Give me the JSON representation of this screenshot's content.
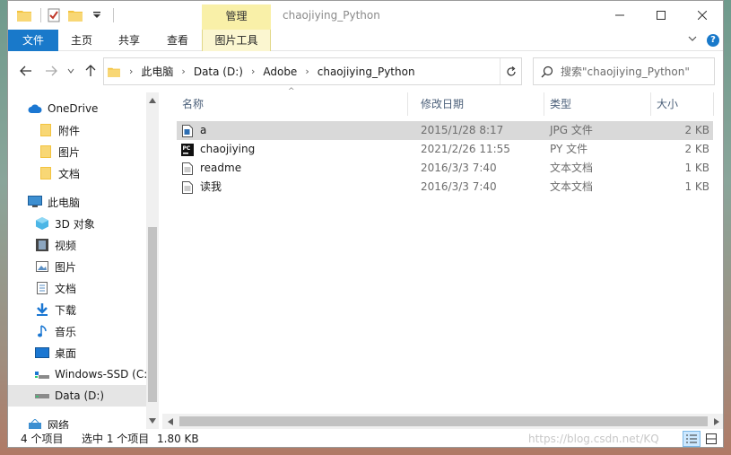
{
  "window": {
    "title": "chaojiying_Python",
    "contextual_tab_header": "管理",
    "minimize_label": "─",
    "maximize_label": "☐",
    "close_label": "✕"
  },
  "ribbon": {
    "tabs": [
      "文件",
      "主页",
      "共享",
      "查看",
      "图片工具"
    ]
  },
  "address": {
    "crumbs": [
      "此电脑",
      "Data (D:)",
      "Adobe",
      "chaojiying_Python"
    ]
  },
  "search": {
    "placeholder": "搜索\"chaojiying_Python\""
  },
  "nav": {
    "items": [
      {
        "label": "OneDrive",
        "icon": "cloud-icon"
      },
      {
        "label": "附件",
        "icon": "folder-icon"
      },
      {
        "label": "图片",
        "icon": "folder-icon"
      },
      {
        "label": "文档",
        "icon": "folder-icon"
      },
      {
        "label": "此电脑",
        "icon": "computer-icon"
      },
      {
        "label": "3D 对象",
        "icon": "cube-icon"
      },
      {
        "label": "视频",
        "icon": "film-icon"
      },
      {
        "label": "图片",
        "icon": "picture-icon"
      },
      {
        "label": "文档",
        "icon": "document-icon"
      },
      {
        "label": "下载",
        "icon": "download-icon"
      },
      {
        "label": "音乐",
        "icon": "music-icon"
      },
      {
        "label": "桌面",
        "icon": "desktop-icon"
      },
      {
        "label": "Windows-SSD (C:",
        "icon": "drive-icon"
      },
      {
        "label": "Data (D:)",
        "icon": "drive-icon"
      },
      {
        "label": "网络",
        "icon": "network-icon"
      }
    ]
  },
  "columns": [
    "名称",
    "修改日期",
    "类型",
    "大小"
  ],
  "files": [
    {
      "name": "a",
      "date": "2015/1/28 8:17",
      "type": "JPG 文件",
      "size": "2 KB",
      "icon": "jpg-file-icon"
    },
    {
      "name": "chaojiying",
      "date": "2021/2/26 11:55",
      "type": "PY 文件",
      "size": "2 KB",
      "icon": "pycharm-file-icon"
    },
    {
      "name": "readme",
      "date": "2016/3/3 7:40",
      "type": "文本文档",
      "size": "1 KB",
      "icon": "text-file-icon"
    },
    {
      "name": "读我",
      "date": "2016/3/3 7:40",
      "type": "文本文档",
      "size": "1 KB",
      "icon": "text-file-icon"
    }
  ],
  "status": {
    "item_count": "4 个项目",
    "selected": "选中 1 个项目",
    "selected_size": "1.80 KB"
  },
  "watermark": "https://blog.csdn.net/KQ",
  "colors": {
    "accent": "#1979ca",
    "selection": "#cce8ff",
    "tool_tab": "#f9f0a8",
    "folder": "#f3c33f"
  }
}
